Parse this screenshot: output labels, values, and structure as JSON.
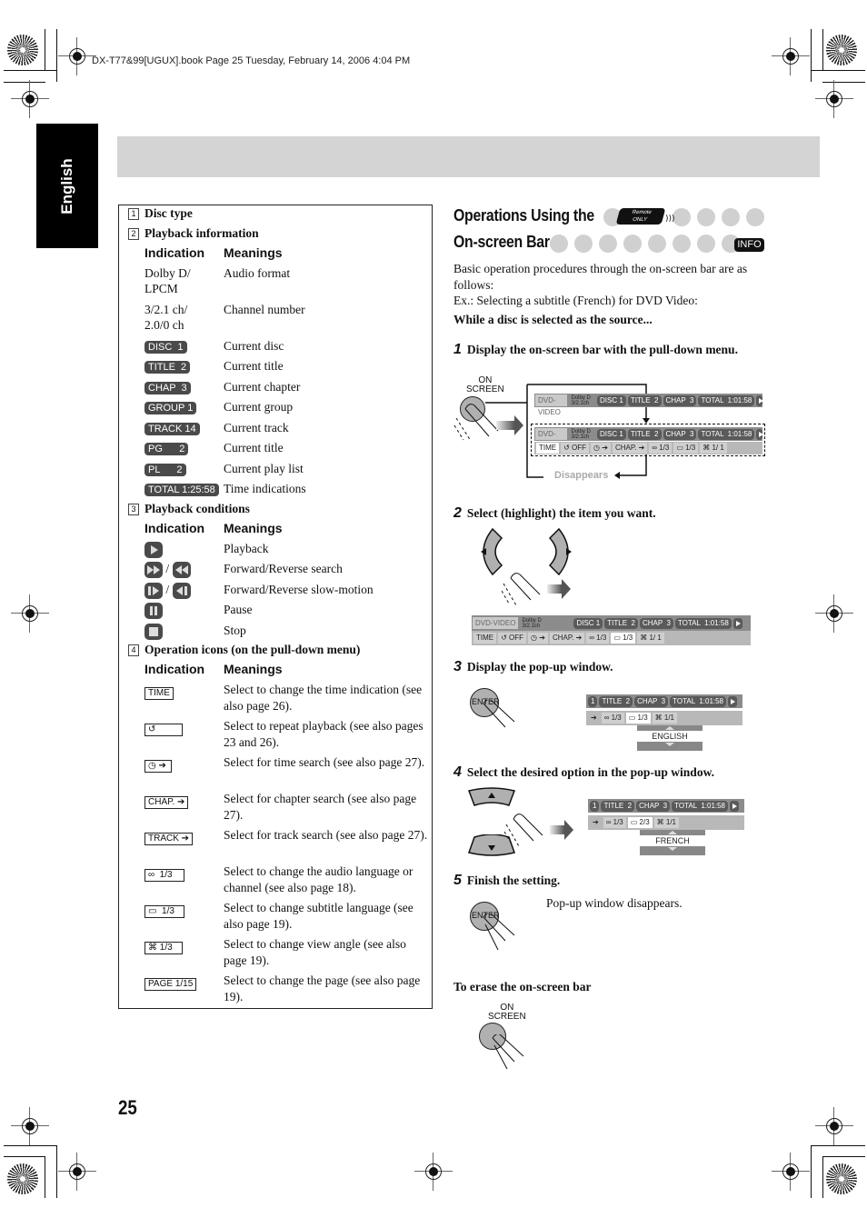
{
  "print_header": "DX-T77&99[UGUX].book  Page 25  Tuesday, February 14, 2006  4:04 PM",
  "language_tab": "English",
  "page_number": "25",
  "left_box": {
    "sections": [
      {
        "num": "1",
        "title": "Disc type"
      },
      {
        "num": "2",
        "title": "Playback information"
      },
      {
        "num": "3",
        "title": "Playback conditions"
      },
      {
        "num": "4",
        "title": "Operation icons (on the pull-down menu)"
      }
    ],
    "col_indication": "Indication",
    "col_meanings": "Meanings",
    "playback_info": [
      {
        "indication": "Dolby D/\nLPCM",
        "meaning": "Audio format",
        "kind": "text"
      },
      {
        "indication": "3/2.1 ch/\n2.0/0 ch",
        "meaning": "Channel number",
        "kind": "text"
      },
      {
        "indication": "DISC  1",
        "meaning": "Current disc",
        "kind": "pill"
      },
      {
        "indication": "TITLE  2",
        "meaning": "Current title",
        "kind": "pill"
      },
      {
        "indication": "CHAP  3",
        "meaning": "Current chapter",
        "kind": "pill"
      },
      {
        "indication": "GROUP 1",
        "meaning": "Current group",
        "kind": "pill"
      },
      {
        "indication": "TRACK 14",
        "meaning": "Current track",
        "kind": "pill"
      },
      {
        "indication": "PG      2",
        "meaning": "Current title",
        "kind": "pill"
      },
      {
        "indication": "PL      2",
        "meaning": "Current play list",
        "kind": "pill"
      },
      {
        "indication": "TOTAL 1:25:58",
        "meaning": "Time indications",
        "kind": "pill"
      }
    ],
    "playback_conditions": [
      {
        "icon": "play-icon",
        "meaning": "Playback"
      },
      {
        "icon": "fast-forward-reverse-icon",
        "meaning": "Forward/Reverse search"
      },
      {
        "icon": "slow-forward-reverse-icon",
        "meaning": "Forward/Reverse slow-motion"
      },
      {
        "icon": "pause-icon",
        "meaning": "Pause"
      },
      {
        "icon": "stop-icon",
        "meaning": "Stop"
      }
    ],
    "operation_icons": [
      {
        "label": "TIME",
        "meaning": "Select to change the time indication (see also page 26)."
      },
      {
        "label": "↺",
        "meaning": "Select to repeat playback (see also pages 23 and 26)."
      },
      {
        "label": "◷ ➔",
        "meaning": "Select for time search (see also page 27)."
      },
      {
        "label": "CHAP. ➔",
        "meaning": "Select for chapter search (see also page 27)."
      },
      {
        "label": "TRACK ➔",
        "meaning": "Select for track search (see also page 27)."
      },
      {
        "label": "∞  1/3",
        "meaning": "Select to change the audio language or channel (see also page 18)."
      },
      {
        "label": "▭  1/3",
        "meaning": "Select to change subtitle language (see also page 19)."
      },
      {
        "label": "⌘ 1/3",
        "meaning": "Select to change view angle (see also page 19)."
      },
      {
        "label": "PAGE 1/15",
        "meaning": "Select to change the page (see also page 19)."
      }
    ]
  },
  "right": {
    "title_line1": "Operations Using the",
    "title_line2": "On-screen Bar",
    "remote_badge": "Remote\nONLY",
    "info_badge": "INFO",
    "intro": "Basic operation procedures through the on-screen bar are as follows:",
    "example": "Ex.: Selecting a subtitle (French) for DVD Video:",
    "while_text": "While a disc is selected as the source...",
    "steps": [
      {
        "num": "1",
        "text": "Display the on-screen bar with the pull-down menu."
      },
      {
        "num": "2",
        "text": "Select (highlight) the item you want."
      },
      {
        "num": "3",
        "text": "Display the pop-up window."
      },
      {
        "num": "4",
        "text": "Select the desired option in the pop-up window."
      },
      {
        "num": "5",
        "text": "Finish the setting."
      }
    ],
    "step5_note": "Pop-up window disappears.",
    "erase_title": "To erase the on-screen bar",
    "on_screen_label": "ON\nSCREEN",
    "enter_label": "ENTER",
    "disappears_label": "Disappears",
    "osd": {
      "disc_type": "DVD-VIDEO",
      "dolby": "Dolby D",
      "channels": "3/2.1ch",
      "disc": "DISC 1",
      "title": "TITLE  2",
      "chap": "CHAP  3",
      "total": "TOTAL  1:01:58",
      "menu": [
        "TIME",
        "↺ OFF",
        "◷ ➔",
        "CHAP. ➔",
        "∞ 1/3",
        "▭ 1/3",
        "⌘ 1/ 1"
      ]
    },
    "popup_step3": {
      "title_seg": "1",
      "subtitle": "▭ 1/3",
      "audio": "∞ 1/3",
      "angle": "⌘ 1/1",
      "value": "ENGLISH"
    },
    "popup_step4": {
      "title_seg": "1",
      "subtitle": "▭ 2/3",
      "audio": "∞ 1/3",
      "angle": "⌘ 1/1",
      "value": "FRENCH"
    }
  }
}
